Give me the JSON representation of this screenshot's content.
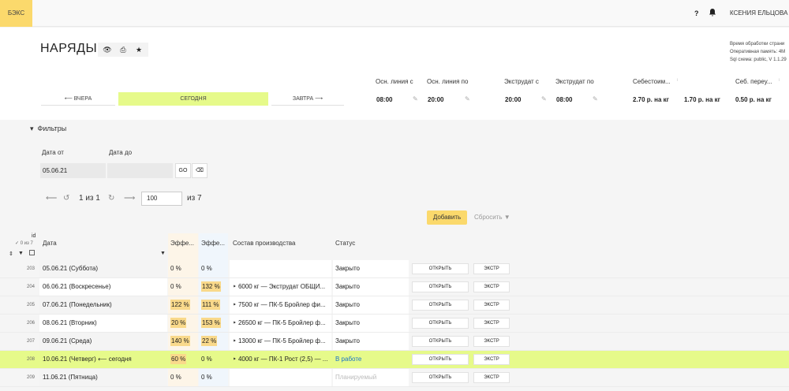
{
  "app": {
    "brand": "БЭКС",
    "help": "?",
    "user": "КСЕНИЯ ЕЛЬЦОВА"
  },
  "page": {
    "title": "НАРЯДЫ",
    "sysinfo": [
      "Время обработки страни",
      "Оперативная память: 4M",
      "Sql схема: public, V 1.1.29"
    ]
  },
  "daynav": {
    "prev": "⟵ ВЧЕРА",
    "today": "СЕГОДНЯ",
    "next": "ЗАВТРА ⟶"
  },
  "params": [
    {
      "label": "Осн. линия с",
      "value": "08:00"
    },
    {
      "label": "Осн. линия по",
      "value": "20:00"
    },
    {
      "label": "Экструдат с",
      "value": "20:00"
    },
    {
      "label": "Экструдат по",
      "value": "08:00"
    },
    {
      "label": "Себестоим...",
      "value": "2.70 р. на кг"
    },
    {
      "label": "",
      "value": "1.70 р. на кг"
    },
    {
      "label": "Себ. переу...",
      "value": "0.50 р. на кг"
    }
  ],
  "filters": {
    "toggle": "Фильтры",
    "date_from_label": "Дата от",
    "date_to_label": "Дата до",
    "date_from_value": "05.06.21",
    "date_to_value": "",
    "go": "GO"
  },
  "pager": {
    "count": "1 из 1",
    "page_size": "100",
    "total": "из 7"
  },
  "actions": {
    "add": "Добавить",
    "reset": "Сбросить"
  },
  "columns": {
    "id": "id",
    "id_sub": "✓ 0 из 7",
    "date": "Дата",
    "eff1": "Эффе...",
    "eff2": "Эффе...",
    "composition": "Состав производства",
    "status": "Статус"
  },
  "rows": [
    {
      "id": "203",
      "date": "05.06.21 (Суббота)",
      "eff1": "0 %",
      "eff2": "0 %",
      "comp": "",
      "status": "Закрыто",
      "open": "ОТКРЫТЬ",
      "extr": "ЭКСТР"
    },
    {
      "id": "204",
      "date": "06.06.21 (Воскресенье)",
      "eff1": "0 %",
      "eff2": "132 %",
      "comp": "‣ 6000 кг — Экструдат ОБЩИ...",
      "status": "Закрыто",
      "open": "ОТКРЫТЬ",
      "extr": "ЭКСТР"
    },
    {
      "id": "205",
      "date": "07.06.21 (Понедельник)",
      "eff1": "122 %",
      "eff2": "111 %",
      "comp": "‣ 7500 кг — ПК-5 Бройлер фи...",
      "status": "Закрыто",
      "open": "ОТКРЫТЬ",
      "extr": "ЭКСТР"
    },
    {
      "id": "206",
      "date": "08.06.21 (Вторник)",
      "eff1": "20 %",
      "eff2": "153 %",
      "comp": "‣ 26500 кг — ПК-5 Бройлер ф...",
      "status": "Закрыто",
      "open": "ОТКРЫТЬ",
      "extr": "ЭКСТР"
    },
    {
      "id": "207",
      "date": "09.06.21 (Среда)",
      "eff1": "140 %",
      "eff2": "22 %",
      "comp": "‣ 13000 кг — ПК-5 Бройлер ф...",
      "status": "Закрыто",
      "open": "ОТКРЫТЬ",
      "extr": "ЭКСТР"
    },
    {
      "id": "208",
      "date": "10.06.21 (Четверг) ⟵ сегодня",
      "eff1": "60 %",
      "eff2": "0 %",
      "comp": "‣ 4000 кг — ПК-1 Рост (2,5) — ...",
      "status": "В работе",
      "open": "ОТКРЫТЬ",
      "extr": "ЭКСТР"
    },
    {
      "id": "209",
      "date": "11.06.21 (Пятница)",
      "eff1": "0 %",
      "eff2": "0 %",
      "comp": "",
      "status": "Планируемый",
      "open": "ОТКРЫТЬ",
      "extr": "ЭКСТР"
    }
  ],
  "colors": {
    "accent": "#fbd96c",
    "today": "#e6fa8a",
    "highlight": "#f9d98b",
    "link": "#1a73c8"
  }
}
